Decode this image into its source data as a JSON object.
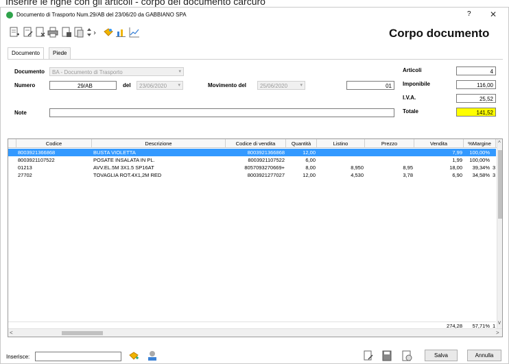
{
  "caption": "Inserire le righe con gli articoli - corpo del documento carcuro",
  "window": {
    "title": "Documento di Trasporto  Num.29/AB  del 23/06/20  da GABBIANO SPA",
    "help": "?",
    "close": "✕"
  },
  "heading": "Corpo documento",
  "toolbar": {
    "icons": [
      "add-row-icon",
      "edit-doc-icon",
      "delete-doc-icon",
      "print-icon",
      "save-doc-icon",
      "copy-doc-icon",
      "sort-icon",
      "star-icon",
      "chart-icon",
      "line-chart-icon"
    ]
  },
  "tabs": [
    {
      "label": "Documento",
      "active": true
    },
    {
      "label": "Piede",
      "active": false
    }
  ],
  "form": {
    "documento_label": "Documento",
    "documento_value": "BA - Documento di Trasporto",
    "numero_label": "Numero",
    "numero_value": "29/AB",
    "del_label": "del",
    "del_value": "23/06/2020",
    "movimento_label": "Movimento del",
    "movimento_value": "25/06/2020",
    "extra_value": "01",
    "note_label": "Note",
    "note_value": "",
    "articoli_label": "Articoli",
    "articoli_value": "4",
    "imponibile_label": "Imponibile",
    "imponibile_value": "116,00",
    "iva_label": "I.V.A.",
    "iva_value": "25,52",
    "totale_label": "Totale",
    "totale_value": "141,52"
  },
  "grid": {
    "columns": [
      "Codice",
      "Descrizione",
      "Codice di vendita",
      "Quantità",
      "Listino",
      "Prezzo",
      "Vendita",
      "%Margine"
    ],
    "rows": [
      {
        "codice": "8003921366868",
        "descrizione": "BUSTA VIOLETTA",
        "codice_vendita": "8003921366868",
        "quantita": "12,00",
        "listino": "",
        "prezzo": "",
        "vendita": "7,99",
        "margine": "100,00%",
        "extra": "",
        "selected": true
      },
      {
        "codice": "8003921107522",
        "descrizione": "POSATE INSALATA IN PL.",
        "codice_vendita": "8003921107522",
        "quantita": "6,00",
        "listino": "",
        "prezzo": "",
        "vendita": "1,99",
        "margine": "100,00%",
        "extra": "",
        "selected": false
      },
      {
        "codice": "01213",
        "descrizione": "AVV.EL.5M 3X1.5 SP16AT",
        "codice_vendita": "8057093270669+",
        "quantita": "8,00",
        "listino": "8,950",
        "prezzo": "8,95",
        "vendita": "18,00",
        "margine": "39,34%",
        "extra": "3",
        "selected": false
      },
      {
        "codice": "27702",
        "descrizione": "TOVAGLIA ROT.4X1,2M RED",
        "codice_vendita": "8003921277027",
        "quantita": "12,00",
        "listino": "4,530",
        "prezzo": "3,78",
        "vendita": "6,90",
        "margine": "34,58%",
        "extra": "3",
        "selected": false
      }
    ],
    "totals": {
      "vendita": "274,28",
      "margine": "57,71%",
      "extra": "1"
    }
  },
  "bottom": {
    "inserisce_label": "Inserisce:",
    "inserisce_value": "",
    "salva_label": "Salva",
    "annulla_label": "Annulla"
  }
}
